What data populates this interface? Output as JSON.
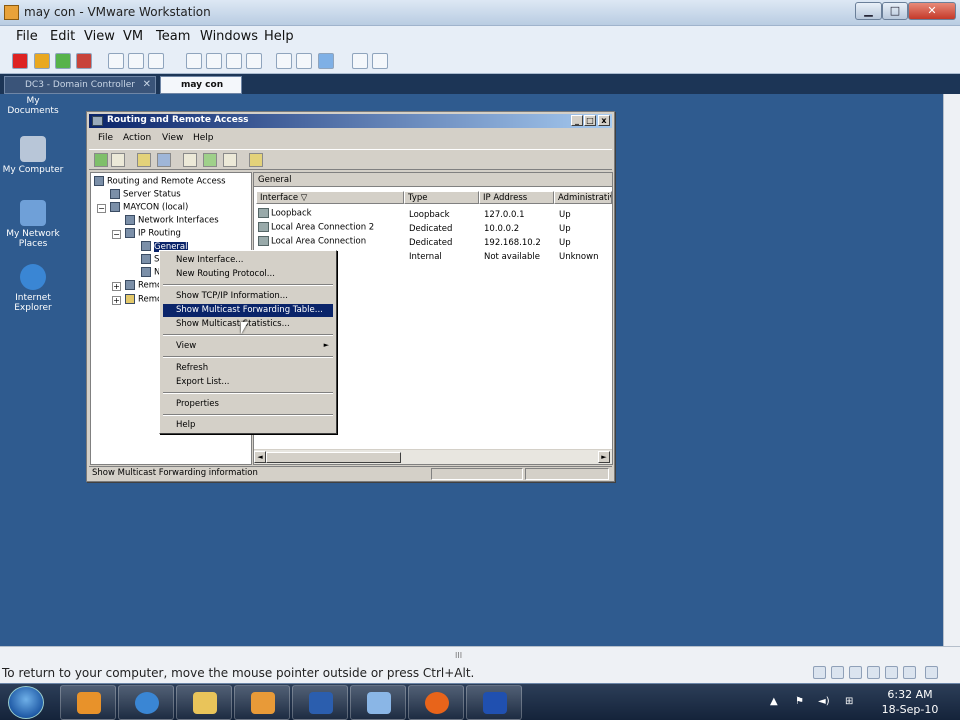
{
  "vm": {
    "title": "may con - VMware Workstation",
    "controls": {
      "min": "▁",
      "max": "□",
      "close": "✕"
    },
    "menu": [
      "File",
      "Edit",
      "View",
      "VM",
      "Team",
      "Windows",
      "Help"
    ],
    "tabs": [
      {
        "label": "DC3 - Domain Controller",
        "close": "✕"
      },
      {
        "label": "may con"
      }
    ],
    "status_message": "To return to your computer, move the mouse pointer outside or press Ctrl+Alt.",
    "hscroll_grip": "III"
  },
  "desktop": {
    "icons": [
      {
        "label": "My Documents"
      },
      {
        "label": "My Computer"
      },
      {
        "label": "My Network Places"
      },
      {
        "label": "Internet Explorer"
      }
    ]
  },
  "rras": {
    "title": "Routing and Remote Access",
    "menu": [
      "File",
      "Action",
      "View",
      "Help"
    ],
    "controls": {
      "min": "_",
      "max": "□",
      "close": "x"
    },
    "tree": [
      {
        "label": "Routing and Remote Access"
      },
      {
        "label": "Server Status"
      },
      {
        "label": "MAYCON (local)"
      },
      {
        "label": "Network Interfaces"
      },
      {
        "label": "IP Routing"
      },
      {
        "label": "General"
      },
      {
        "label": "S"
      },
      {
        "label": "N"
      },
      {
        "label": "Remo"
      },
      {
        "label": "Remo"
      }
    ],
    "pane_header": "General",
    "columns": [
      "Interface",
      "Type",
      "IP Address",
      "Administrativ"
    ],
    "sort_indicator": "▽",
    "rows": [
      {
        "interface": "Loopback",
        "type": "Loopback",
        "ip": "127.0.0.1",
        "admin": "Up"
      },
      {
        "interface": "Local Area Connection 2",
        "type": "Dedicated",
        "ip": "10.0.0.2",
        "admin": "Up"
      },
      {
        "interface": "Local Area Connection",
        "type": "Dedicated",
        "ip": "192.168.10.2",
        "admin": "Up"
      },
      {
        "interface": "",
        "type": "Internal",
        "ip": "Not available",
        "admin": "Unknown"
      }
    ],
    "scroll": {
      "left": "◄",
      "right": "►"
    },
    "status": "Show Multicast Forwarding information"
  },
  "context_menu": {
    "items": [
      "New Interface...",
      "New Routing Protocol...",
      "Show TCP/IP Information...",
      "Show Multicast Forwarding Table...",
      "Show Multicast Statistics...",
      "View",
      "Refresh",
      "Export List...",
      "Properties",
      "Help"
    ],
    "submenu_arrow": "►",
    "highlighted": "Show Multicast Forwarding Table..."
  },
  "taskbar": {
    "time": "6:32 AM",
    "date": "18-Sep-10",
    "apps": [
      {
        "icon": "media-player-icon",
        "color": "#e8922a"
      },
      {
        "icon": "internet-explorer-icon",
        "color": "#3a86d4"
      },
      {
        "icon": "folder-icon",
        "color": "#e9c45a"
      },
      {
        "icon": "vmware-icon",
        "color": "#e89a38"
      },
      {
        "icon": "word-icon",
        "color": "#2b5eae"
      },
      {
        "icon": "paint-icon",
        "color": "#8ab6e6"
      },
      {
        "icon": "firefox-icon",
        "color": "#e8641a"
      },
      {
        "icon": "network-app-icon",
        "color": "#2050b0"
      }
    ],
    "tray": {
      "up": "▲",
      "flag": "⚑",
      "speaker": "◄)",
      "network": "⊞"
    }
  },
  "colors": {
    "guest_desktop": "#2f5b8f",
    "selection": "#0a246a",
    "window_face": "#d4d0c8"
  }
}
